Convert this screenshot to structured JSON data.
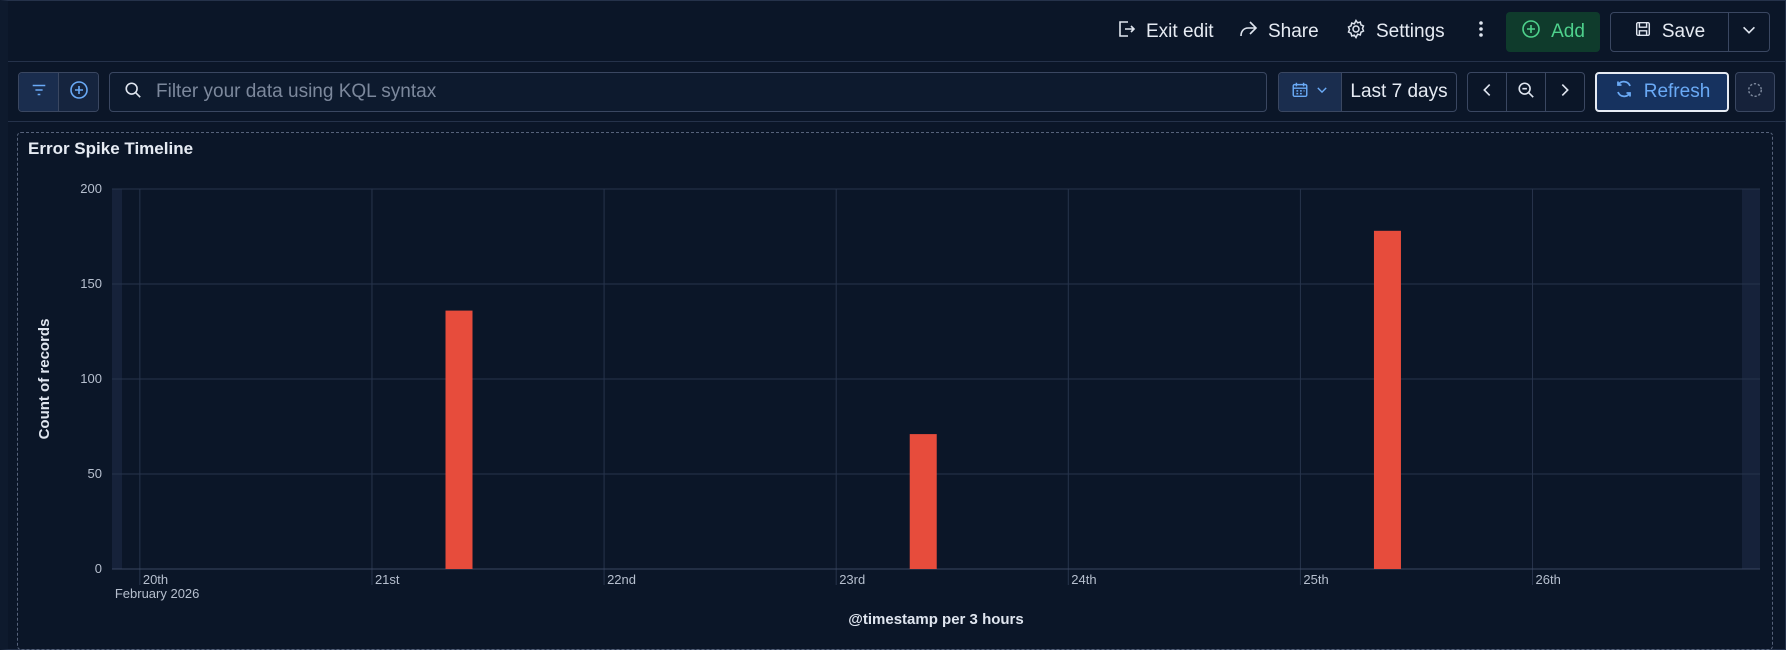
{
  "toolbar": {
    "exit_edit_label": "Exit edit",
    "share_label": "Share",
    "settings_label": "Settings",
    "add_label": "Add",
    "save_label": "Save",
    "add_color": "#4ed18c"
  },
  "query": {
    "search_placeholder": "Filter your data using KQL syntax",
    "search_value": "",
    "time_range": "Last 7 days",
    "refresh_label": "Refresh"
  },
  "panel": {
    "title": "Error Spike Timeline"
  },
  "chart_data": {
    "type": "bar",
    "title": "Error Spike Timeline",
    "xlabel": "@timestamp per 3 hours",
    "ylabel": "Count of records",
    "ylim": [
      0,
      200
    ],
    "yticks": [
      0,
      50,
      100,
      150,
      200
    ],
    "xticks": [
      {
        "label": "20th",
        "sublabel": "February 2026",
        "day": 20
      },
      {
        "label": "21st",
        "sublabel": "",
        "day": 21
      },
      {
        "label": "22nd",
        "sublabel": "",
        "day": 22
      },
      {
        "label": "23rd",
        "sublabel": "",
        "day": 23
      },
      {
        "label": "24th",
        "sublabel": "",
        "day": 24
      },
      {
        "label": "25th",
        "sublabel": "",
        "day": 25
      },
      {
        "label": "26th",
        "sublabel": "",
        "day": 26
      }
    ],
    "xlim_days": [
      19.88,
      26.98
    ],
    "series": [
      {
        "points": [
          {
            "x": "2026-02-21T09:00",
            "day": 21.375,
            "value": 136
          },
          {
            "x": "2026-02-23T09:00",
            "day": 23.375,
            "value": 71
          },
          {
            "x": "2026-02-25T09:00",
            "day": 25.375,
            "value": 178
          }
        ],
        "color": "#e74c3c"
      }
    ],
    "grid": true
  }
}
